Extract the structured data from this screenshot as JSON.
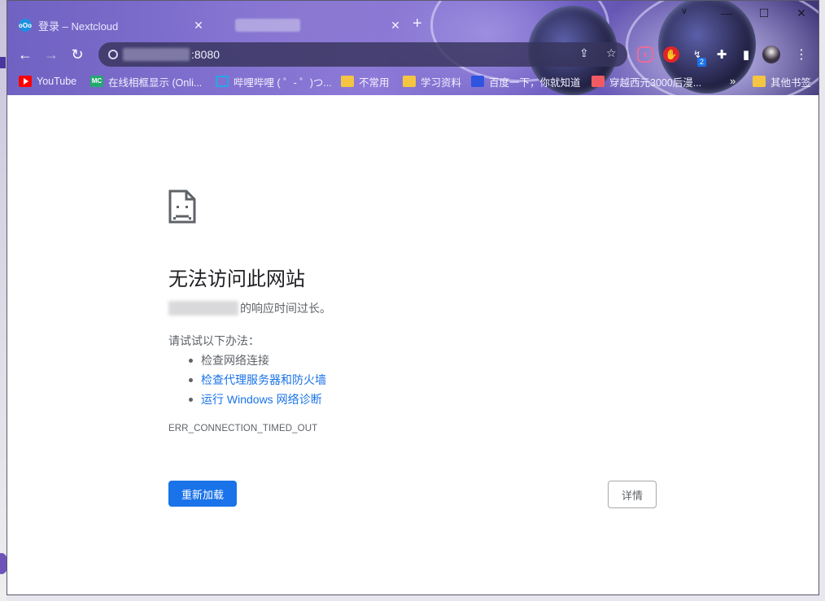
{
  "window": {
    "controls": {
      "minimize": "—",
      "maximize": "☐",
      "close": "✕"
    },
    "tab_strip_chevron": "∨"
  },
  "tabs": [
    {
      "title": "登录 – Nextcloud",
      "favicon": "nextcloud-icon",
      "active": true,
      "close": "✕"
    },
    {
      "title": "",
      "active": false,
      "close": "✕"
    }
  ],
  "new_tab": "+",
  "toolbar": {
    "back": "←",
    "forward": "→",
    "reload": "↻",
    "omnibox": {
      "port": ":8080"
    },
    "share": "⇪",
    "star": "☆",
    "extension_badge": "2",
    "menu": "⋮"
  },
  "bookmarks": {
    "items": [
      {
        "label": "YouTube",
        "icon": "youtube-icon"
      },
      {
        "label": "在线相框显示 (Onli...",
        "icon": "mc-icon"
      },
      {
        "label": "哔哩哔哩 ( ゜- ゜)つ...",
        "icon": "bilibili-icon"
      },
      {
        "label": "不常用",
        "icon": "folder-icon"
      },
      {
        "label": "学习资料",
        "icon": "folder-icon"
      },
      {
        "label": "百度一下，你就知道",
        "icon": "baidu-icon"
      },
      {
        "label": "穿越西元3000后漫...",
        "icon": "manga-icon"
      }
    ],
    "more": "»",
    "other": {
      "label": "其他书签",
      "icon": "folder-icon"
    }
  },
  "error_page": {
    "title": "无法访问此网站",
    "subtitle_suffix": "的响应时间过长。",
    "try_label": "请试试以下办法：",
    "suggestions": [
      {
        "text": "检查网络连接",
        "link": false
      },
      {
        "text": "检查代理服务器和防火墙",
        "link": true
      },
      {
        "text": "运行 Windows 网络诊断",
        "link": true
      }
    ],
    "error_code": "ERR_CONNECTION_TIMED_OUT",
    "reload_button": "重新加载",
    "details_button": "详情"
  },
  "colors": {
    "accent": "#1a73e8",
    "text_primary": "#202124",
    "text_secondary": "#5f6368"
  }
}
